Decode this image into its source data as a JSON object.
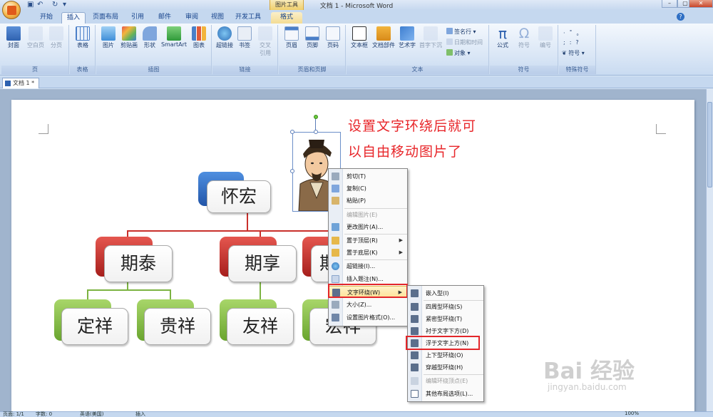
{
  "window": {
    "title": "文档 1 - Microsoft Word",
    "tool_context": "图片工具",
    "minimize": "–",
    "maximize": "▢",
    "close": "✕",
    "help": "?"
  },
  "tabs": [
    {
      "label": "开始"
    },
    {
      "label": "插入"
    },
    {
      "label": "页面布局"
    },
    {
      "label": "引用"
    },
    {
      "label": "邮件"
    },
    {
      "label": "审阅"
    },
    {
      "label": "视图"
    },
    {
      "label": "开发工具"
    },
    {
      "label": "格式"
    }
  ],
  "ribbon": {
    "groups": [
      {
        "label": "页"
      },
      {
        "label": "表格"
      },
      {
        "label": "插图"
      },
      {
        "label": "链接"
      },
      {
        "label": "页眉和页脚"
      },
      {
        "label": "文本"
      },
      {
        "label": "符号"
      },
      {
        "label": "特殊符号"
      }
    ],
    "buttons": {
      "cover": "封面",
      "blank": "空白页",
      "pagebreak": "分页",
      "table": "表格",
      "picture": "图片",
      "clipart": "剪贴画",
      "shapes": "形状",
      "smartart": "SmartArt",
      "chart": "图表",
      "hyperlink": "超链接",
      "bookmark": "书签",
      "crossref_1": "交叉",
      "crossref_2": "引用",
      "header": "页眉",
      "footer": "页脚",
      "pagenum": "页码",
      "textbox": "文本框",
      "quickparts": "文档部件",
      "wordart": "艺术字",
      "dropcap": "首字下沉",
      "signature": "签名行",
      "datetime": "日期和时间",
      "object": "对象",
      "equation": "公式",
      "symbol": "符号",
      "number": "编号",
      "special_symbol": "符号"
    }
  },
  "doc_tab": {
    "label": "文档 1 *"
  },
  "annotation": {
    "line1": "设置文字环绕后就可",
    "line2": "以自由移动图片了"
  },
  "orgchart": {
    "root": "怀宏",
    "level2": [
      "期泰",
      "期享",
      "期"
    ],
    "level3": [
      "定祥",
      "贵祥",
      "友祥",
      "宏祥"
    ]
  },
  "context_menu": [
    {
      "label": "剪切(T)",
      "enabled": true,
      "icon": "scissors-icon"
    },
    {
      "label": "复制(C)",
      "enabled": true,
      "icon": "copy-icon"
    },
    {
      "label": "粘贴(P)",
      "enabled": true,
      "icon": "paste-icon"
    },
    {
      "label": "编辑图片(E)",
      "enabled": false,
      "icon": ""
    },
    {
      "label": "更改图片(A)...",
      "enabled": true,
      "icon": "change-picture-icon"
    },
    {
      "label": "置于顶层(R)",
      "enabled": true,
      "icon": "bring-front-icon",
      "submenu": true
    },
    {
      "label": "置于底层(K)",
      "enabled": true,
      "icon": "send-back-icon",
      "submenu": true
    },
    {
      "label": "超链接(I)...",
      "enabled": true,
      "icon": "hyperlink-icon"
    },
    {
      "label": "插入题注(N)...",
      "enabled": true,
      "icon": "caption-icon"
    },
    {
      "label": "文字环绕(W)",
      "enabled": true,
      "icon": "text-wrap-icon",
      "submenu": true,
      "highlighted": true
    },
    {
      "label": "大小(Z)...",
      "enabled": true,
      "icon": "size-icon"
    },
    {
      "label": "设置图片格式(O)...",
      "enabled": true,
      "icon": "format-picture-icon"
    }
  ],
  "wrap_submenu": [
    {
      "label": "嵌入型(I)",
      "enabled": true
    },
    {
      "label": "四周型环绕(S)",
      "enabled": true
    },
    {
      "label": "紧密型环绕(T)",
      "enabled": true
    },
    {
      "label": "衬于文字下方(D)",
      "enabled": true
    },
    {
      "label": "浮于文字上方(N)",
      "enabled": true,
      "selected": true
    },
    {
      "label": "上下型环绕(O)",
      "enabled": true
    },
    {
      "label": "穿越型环绕(H)",
      "enabled": true
    },
    {
      "label": "编辑环绕顶点(E)",
      "enabled": false
    },
    {
      "label": "其他布局选项(L)...",
      "enabled": true
    }
  ],
  "status": {
    "page": "页面: 1/1",
    "words": "字数: 0",
    "lang": "英语(美国)",
    "mode": "插入",
    "zoom": "100%"
  },
  "watermark": {
    "main": "Bai 经验",
    "sub": "jingyan.baidu.com"
  },
  "colors": {
    "accent_red": "#e3262a",
    "box_blue": "#2f74c8",
    "box_red": "#c9302c",
    "box_green": "#7cb342"
  }
}
